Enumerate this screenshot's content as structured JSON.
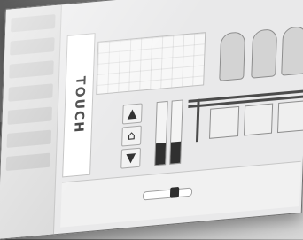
{
  "brand": {
    "label": "TOUCH"
  },
  "icons": [
    "arrow-up-icon",
    "home-icon",
    "arrow-down-icon",
    "silo-icon"
  ]
}
